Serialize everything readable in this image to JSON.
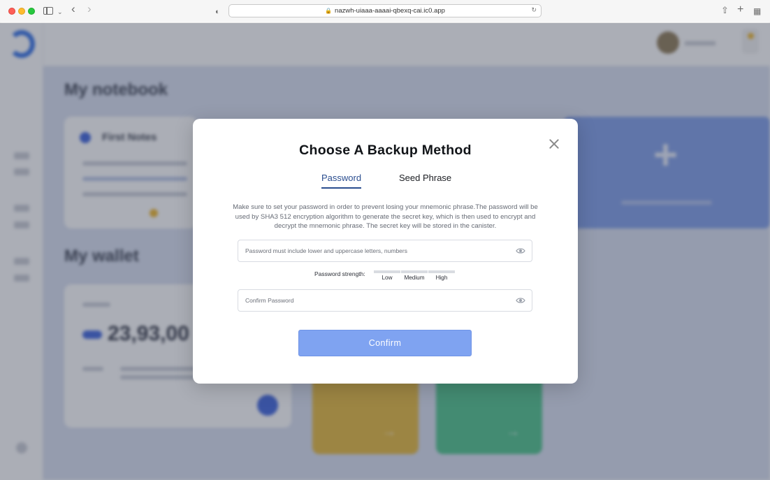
{
  "browser": {
    "url": "nazwh-uiaaa-aaaai-qbexq-cai.ic0.app"
  },
  "background": {
    "notebook_heading": "My notebook",
    "first_notes_title": "First Notes",
    "wallet_heading": "My wallet",
    "wallet_amount": "23,93,00"
  },
  "modal": {
    "title": "Choose A Backup Method",
    "tabs": [
      {
        "label": "Password",
        "active": true
      },
      {
        "label": "Seed Phrase",
        "active": false
      }
    ],
    "description": "Make sure to set your password in order to prevent losing your mnemonic phrase.The password will be used by SHA3 512 encryption algorithm to generate the secret key, which is then used to encrypt and decrypt the mnemonic phrase. The secret key will be stored in the canister.",
    "password_field": {
      "placeholder": "Password must include lower and uppercase letters, numbers",
      "value": ""
    },
    "strength": {
      "label": "Password strength:",
      "levels": [
        "Low",
        "Medium",
        "High"
      ]
    },
    "confirm_field": {
      "placeholder": "Confirm Password",
      "value": ""
    },
    "confirm_button": "Confirm"
  },
  "colors": {
    "accent": "#2a4d8f",
    "button": "#7fa3f1"
  },
  "icons": [
    "sidebar-toggle-icon",
    "back-icon",
    "forward-icon",
    "shield-icon",
    "lock-icon",
    "translate-icon",
    "reload-icon",
    "share-icon",
    "new-tab-icon",
    "tab-overview-icon",
    "close-icon",
    "eye-icon"
  ]
}
